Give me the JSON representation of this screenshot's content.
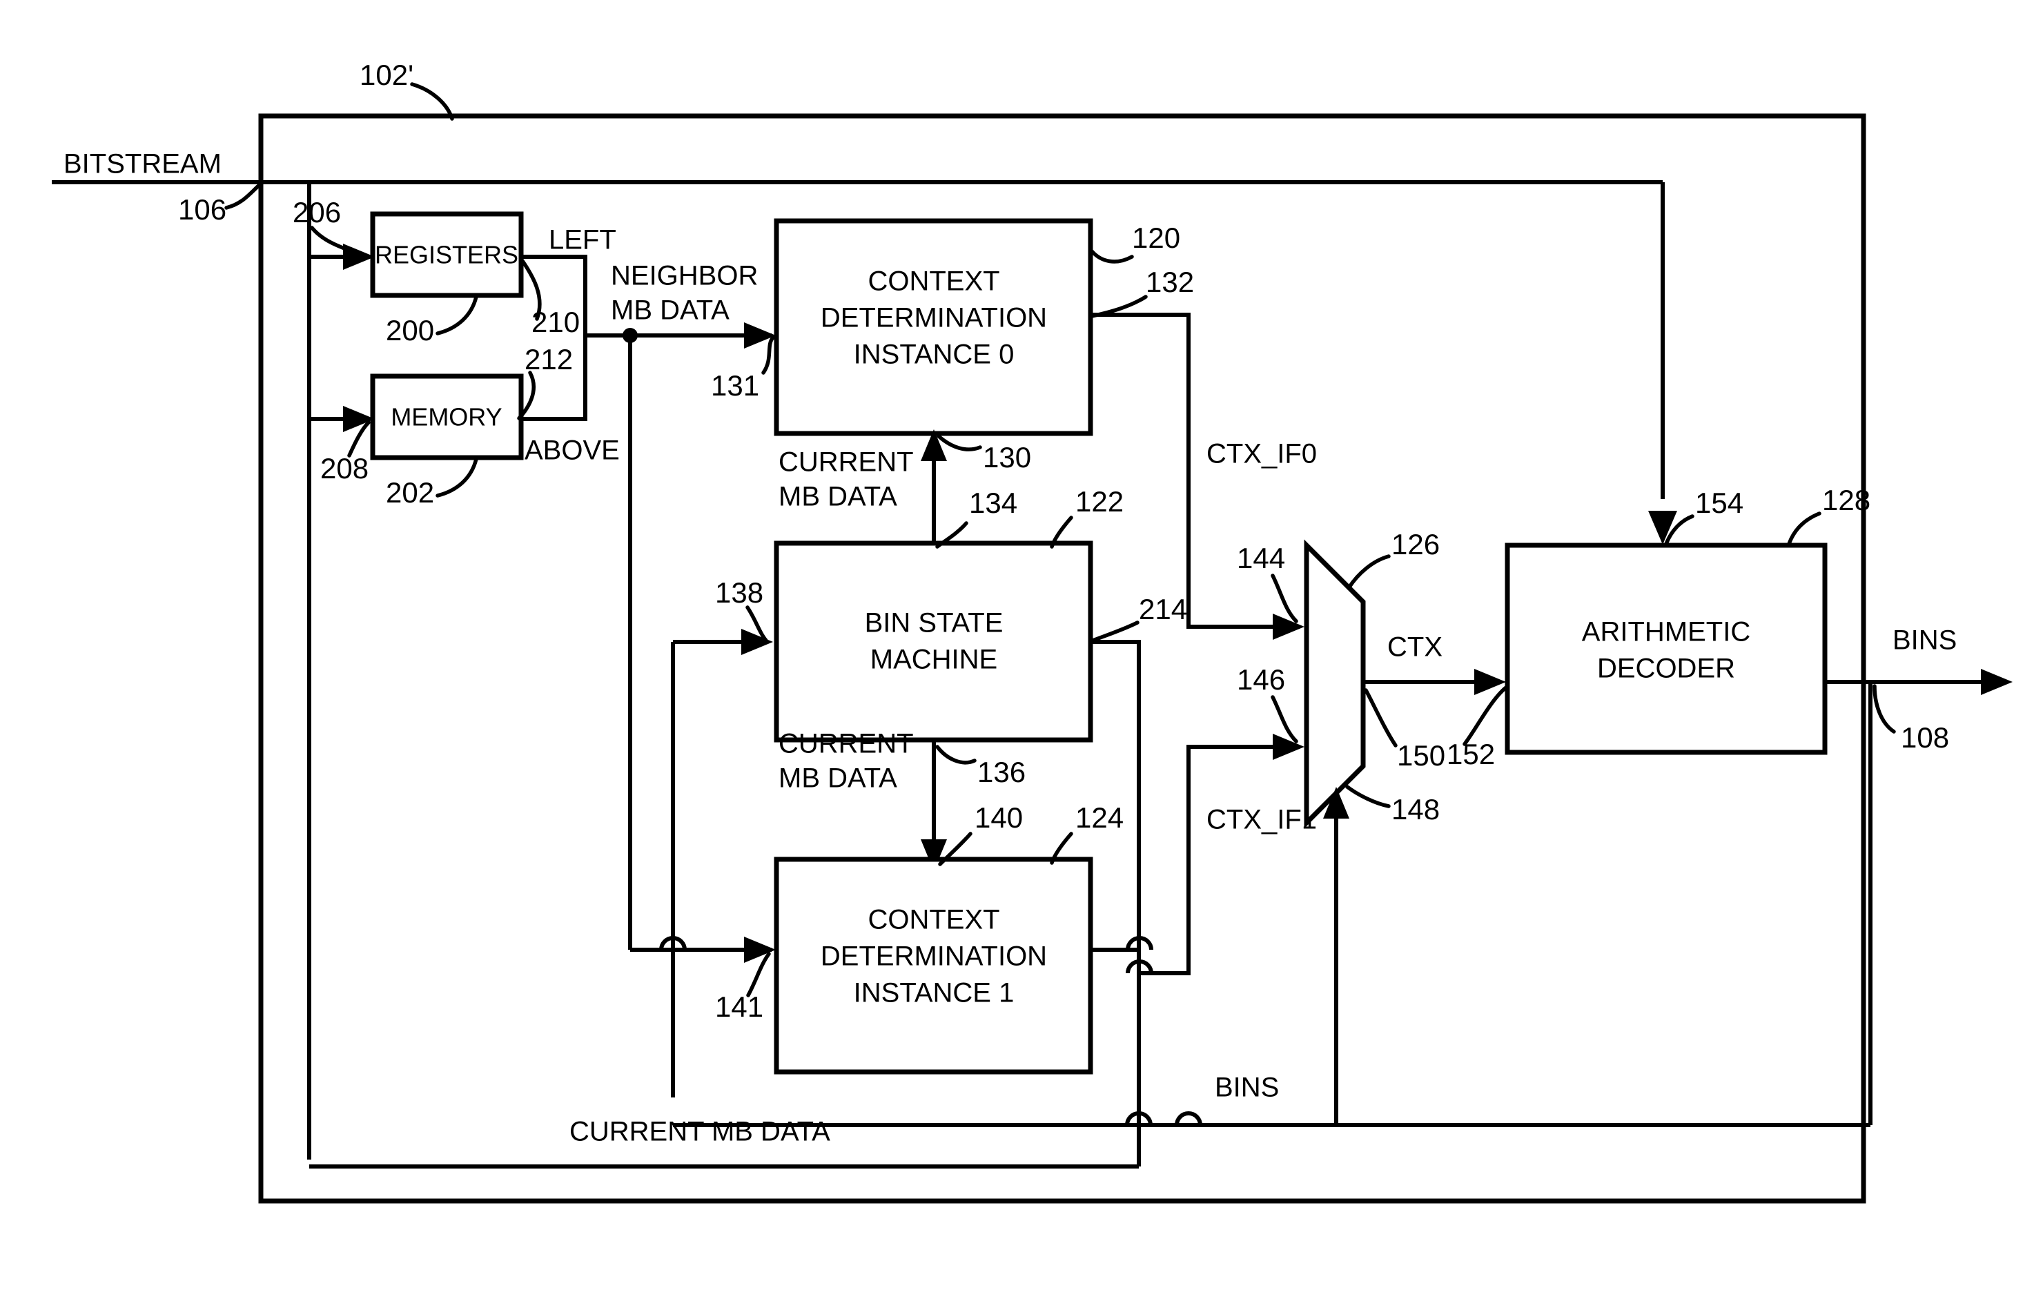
{
  "figure": {
    "kind": "patent-block-diagram",
    "background_color": "#ffffff",
    "line_color": "#000000"
  },
  "blocks": {
    "registers": {
      "label": "REGISTERS",
      "ref": "200"
    },
    "memory": {
      "label": "MEMORY",
      "ref": "202"
    },
    "context0": {
      "line1": "CONTEXT",
      "line2": "DETERMINATION",
      "line3": "INSTANCE 0",
      "ref": "120"
    },
    "bin_state_machine": {
      "line1": "BIN STATE",
      "line2": "MACHINE",
      "ref": "122"
    },
    "context1": {
      "line1": "CONTEXT",
      "line2": "DETERMINATION",
      "line3": "INSTANCE 1",
      "ref": "124"
    },
    "mux": {
      "ref": "126"
    },
    "arithmetic_decoder": {
      "line1": "ARITHMETIC",
      "line2": "DECODER",
      "ref": "128"
    },
    "outer": {
      "ref": "102'"
    }
  },
  "signals": {
    "bitstream": "BITSTREAM",
    "bitstream_ref": "106",
    "left": "LEFT",
    "above": "ABOVE",
    "neighbor_mb_data_line1": "NEIGHBOR",
    "neighbor_mb_data_line2": "MB DATA",
    "current_mb_data_top_line1": "CURRENT",
    "current_mb_data_top_line2": "MB DATA",
    "current_mb_data_mid_line1": "CURRENT",
    "current_mb_data_mid_line2": "MB DATA",
    "current_mb_data_bottom": "CURRENT MB DATA",
    "ctx_if0": "CTX_IF0",
    "ctx_if1": "CTX_IF1",
    "ctx": "CTX",
    "bins_internal": "BINS",
    "bins_output": "BINS",
    "bins_output_ref": "108"
  },
  "reference_numerals": {
    "outer_box": "102'",
    "bitstream_in": "106",
    "bins_out": "108",
    "context0_box": "120",
    "bin_state_machine_box": "122",
    "context1_box": "124",
    "mux_box": "126",
    "arith_decoder_box": "128",
    "current_mb_into_ctx0": "130",
    "neighbor_into_ctx0": "131",
    "ctx0_output": "132",
    "bsm_top_output": "134",
    "bsm_bottom_output": "136",
    "bsm_left_input": "138",
    "ctx1_top_input": "140",
    "ctx1_left_input": "141",
    "mux_input_0": "144",
    "mux_input_1": "146",
    "mux_select": "148",
    "mux_output": "150",
    "decoder_ctx_input": "152",
    "decoder_bitstream_input": "154",
    "registers_block": "200",
    "memory_block": "202",
    "bitstream_to_registers": "206",
    "bitstream_to_memory": "208",
    "registers_left_out": "210",
    "memory_above_out": "212",
    "bsm_right_out": "214"
  }
}
